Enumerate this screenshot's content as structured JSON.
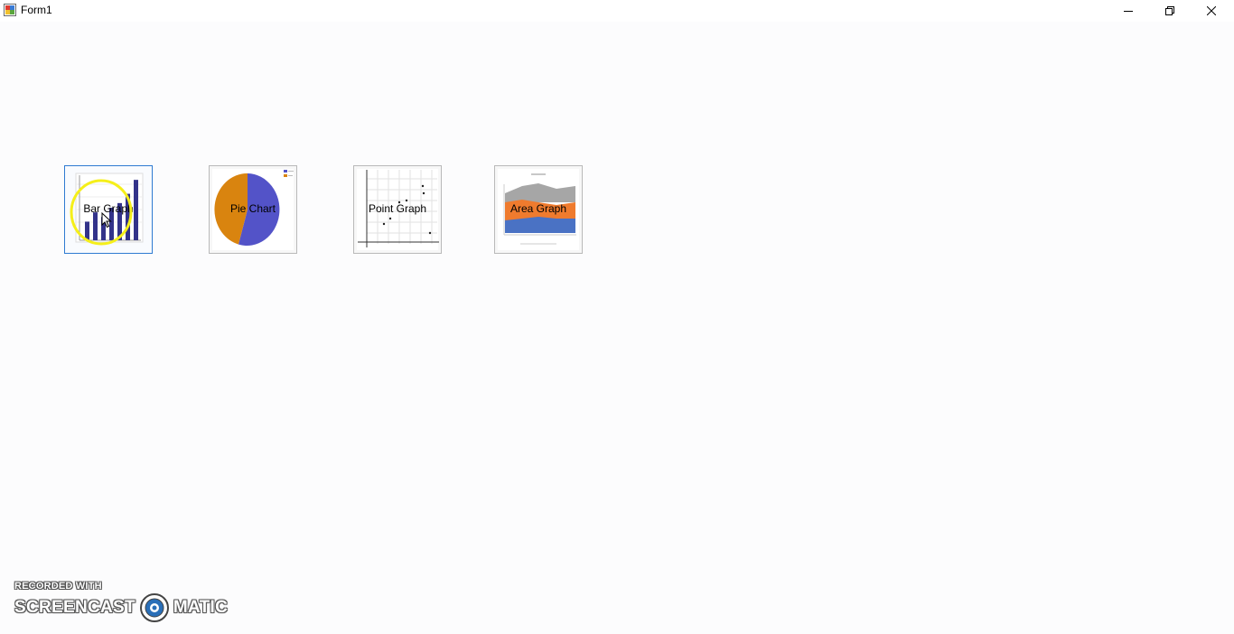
{
  "window": {
    "title": "Form1",
    "controls": {
      "minimize": "minimize-icon",
      "restore": "restore-icon",
      "close": "close-icon"
    }
  },
  "buttons": [
    {
      "id": "bar",
      "label": "Bar Graph",
      "icon": "bar-chart-icon",
      "focused": true
    },
    {
      "id": "pie",
      "label": "Pie Chart",
      "icon": "pie-chart-icon"
    },
    {
      "id": "point",
      "label": "Point Graph",
      "icon": "scatter-chart-icon"
    },
    {
      "id": "area",
      "label": "Area Graph",
      "icon": "area-chart-icon"
    }
  ],
  "thumbnails": {
    "bar": {
      "values": [
        4,
        6,
        5,
        7,
        8,
        10,
        13
      ],
      "color": "#33338a"
    },
    "pie": {
      "slices": [
        0.55,
        0.45
      ],
      "colors": [
        "#5353c8",
        "#d9840f"
      ],
      "legend_colors": [
        "#5353c8",
        "#d9840f"
      ]
    },
    "area": {
      "colors": [
        "#a6a6a6",
        "#ef7b2e",
        "#4a72c4"
      ]
    }
  },
  "overlay": {
    "highlight_color": "#f5ef1a"
  },
  "watermark": {
    "line1": "RECORDED WITH",
    "left_word": "SCREENCAST",
    "right_word": "MATIC"
  }
}
